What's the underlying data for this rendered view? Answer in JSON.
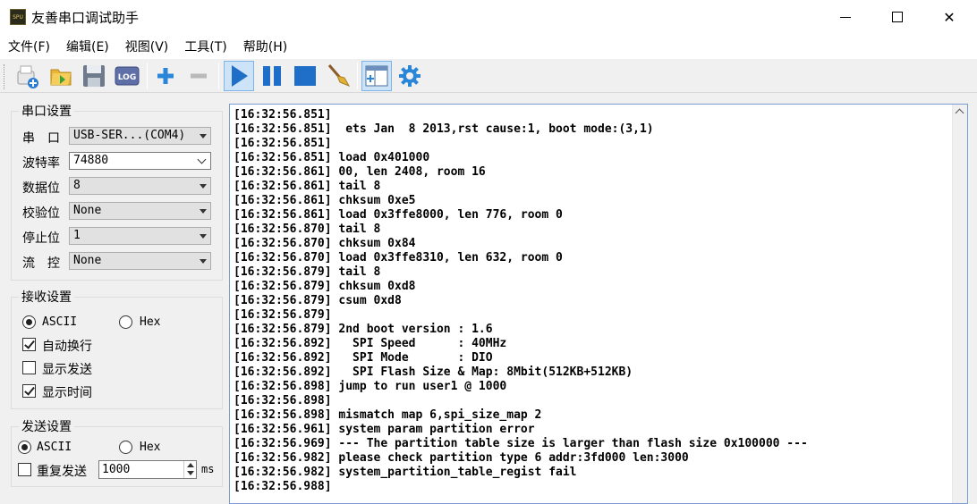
{
  "window": {
    "title": "友善串口调试助手",
    "app_icon_text": "SPU",
    "controls": {
      "minimize": "─",
      "maximize": "☐",
      "close": "✕"
    }
  },
  "menu": [
    "文件(F)",
    "编辑(E)",
    "视图(V)",
    "工具(T)",
    "帮助(H)"
  ],
  "toolbar": {
    "icons": [
      "new-session-icon",
      "open-folder-icon",
      "save-icon",
      "log-icon",
      "add-icon",
      "remove-icon",
      "play-icon",
      "pause-icon",
      "stop-icon",
      "clear-broom-icon",
      "layout-icon",
      "settings-gear-icon"
    ],
    "log_label": "LOG"
  },
  "serial_settings": {
    "title": "串口设置",
    "port_label": "串　口",
    "port_value": "USB-SER...(COM4)",
    "baud_label": "波特率",
    "baud_value": "74880",
    "databits_label": "数据位",
    "databits_value": "8",
    "parity_label": "校验位",
    "parity_value": "None",
    "stopbits_label": "停止位",
    "stopbits_value": "1",
    "flow_label": "流　控",
    "flow_value": "None"
  },
  "receive_settings": {
    "title": "接收设置",
    "ascii_label": "ASCII",
    "hex_label": "Hex",
    "auto_wrap_label": "自动换行",
    "show_send_label": "显示发送",
    "show_time_label": "显示时间"
  },
  "send_settings": {
    "title": "发送设置",
    "ascii_label": "ASCII",
    "hex_label": "Hex",
    "repeat_label": "重复发送",
    "interval_value": "1000",
    "unit": "ms"
  },
  "log": [
    "[16:32:56.851]",
    "[16:32:56.851]  ets Jan  8 2013,rst cause:1, boot mode:(3,1)",
    "[16:32:56.851]",
    "[16:32:56.851] load 0x401000",
    "[16:32:56.861] 00, len 2408, room 16",
    "[16:32:56.861] tail 8",
    "[16:32:56.861] chksum 0xe5",
    "[16:32:56.861] load 0x3ffe8000, len 776, room 0",
    "[16:32:56.870] tail 8",
    "[16:32:56.870] chksum 0x84",
    "[16:32:56.870] load 0x3ffe8310, len 632, room 0",
    "[16:32:56.879] tail 8",
    "[16:32:56.879] chksum 0xd8",
    "[16:32:56.879] csum 0xd8",
    "[16:32:56.879]",
    "[16:32:56.879] 2nd boot version : 1.6",
    "[16:32:56.892]   SPI Speed      : 40MHz",
    "[16:32:56.892]   SPI Mode       : DIO",
    "[16:32:56.892]   SPI Flash Size & Map: 8Mbit(512KB+512KB)",
    "[16:32:56.898] jump to run user1 @ 1000",
    "[16:32:56.898]",
    "[16:32:56.898] mismatch map 6,spi_size_map 2",
    "[16:32:56.961] system param partition error",
    "[16:32:56.969] --- The partition table size is larger than flash size 0x100000 ---",
    "[16:32:56.982] please check partition type 6 addr:3fd000 len:3000",
    "[16:32:56.982] system_partition_table_regist fail",
    "[16:32:56.988]"
  ]
}
